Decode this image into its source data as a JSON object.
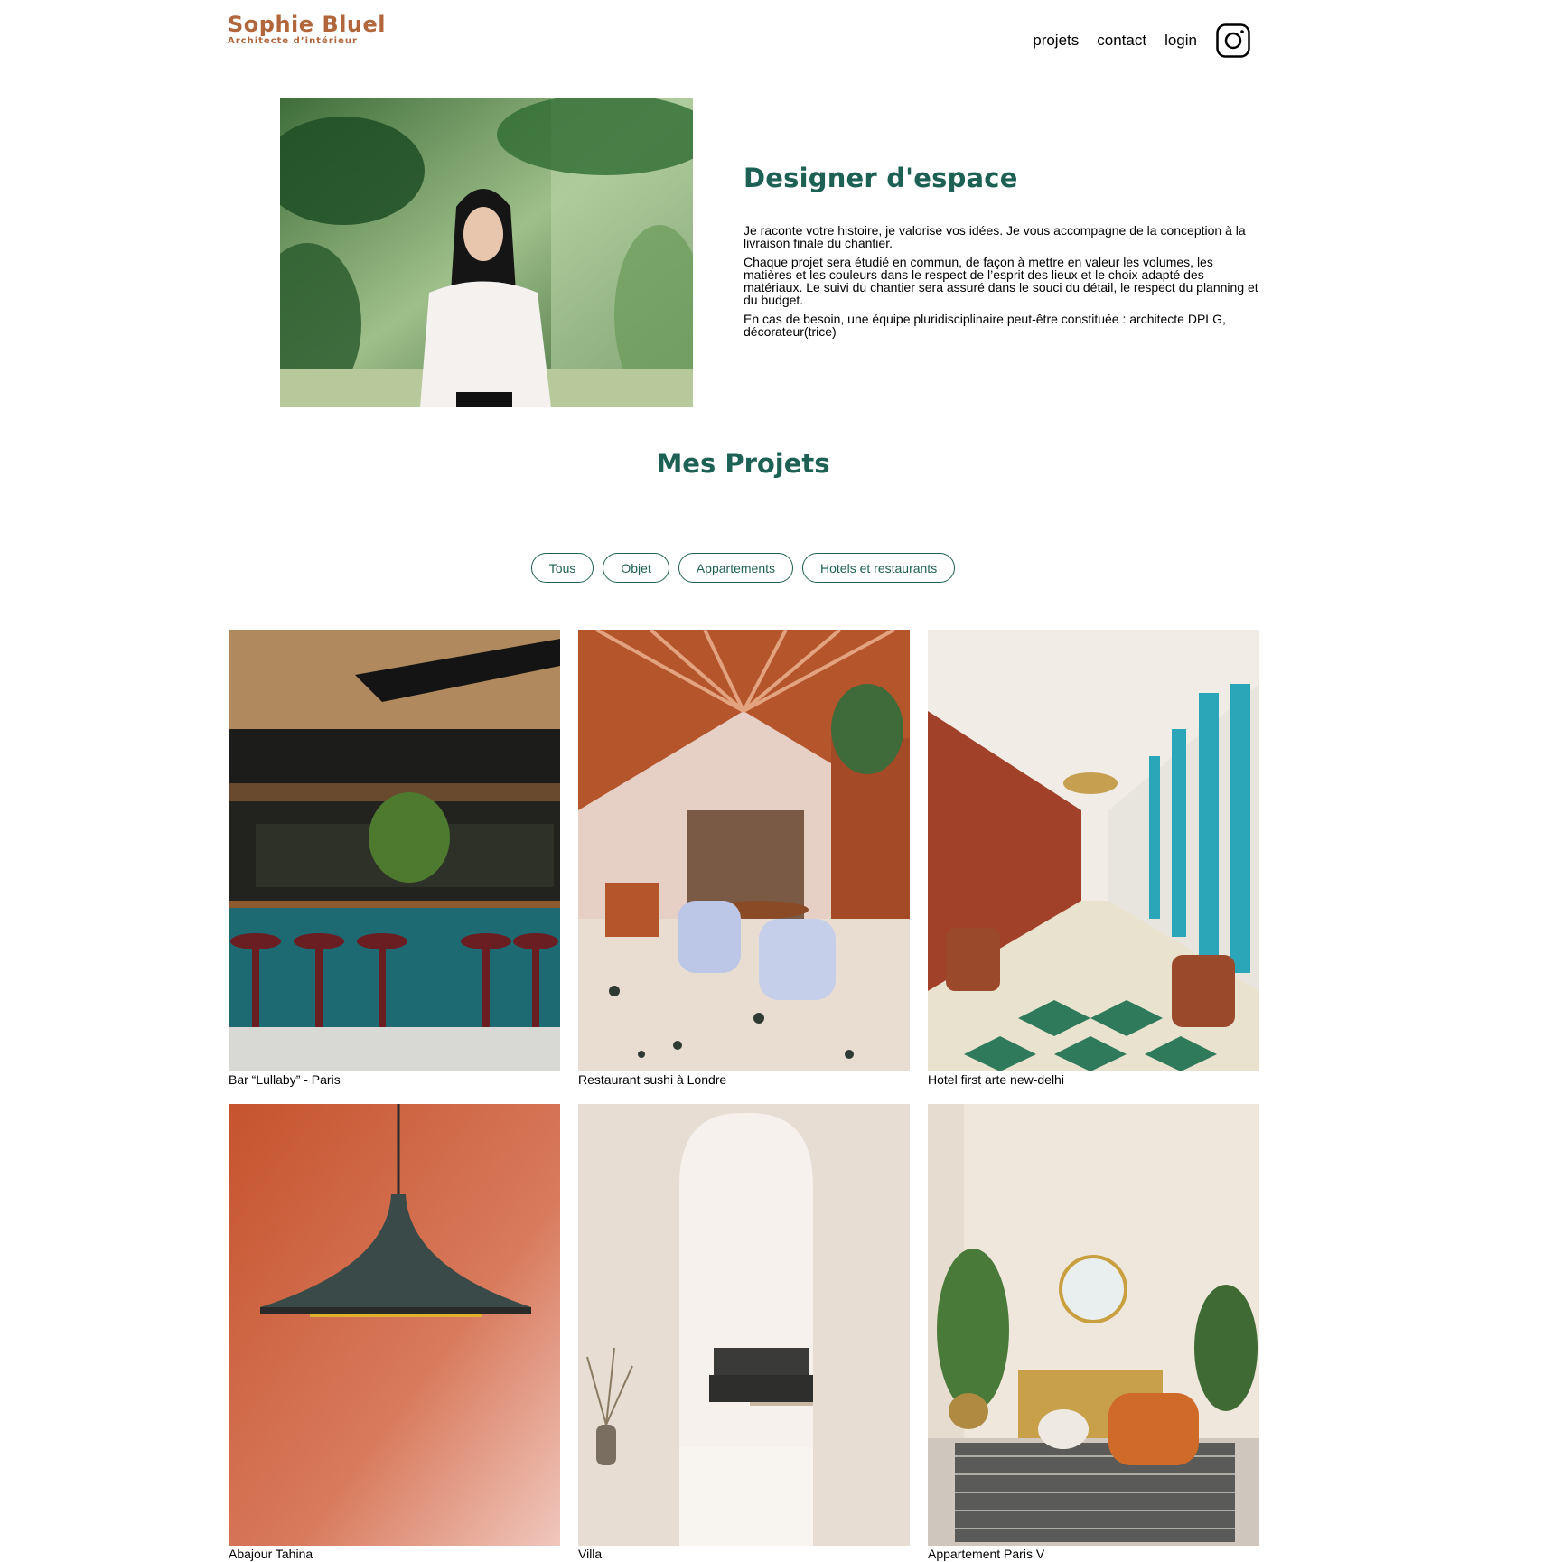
{
  "header": {
    "logo_name": "Sophie Bluel",
    "logo_subtitle": "Architecte d’intérieur",
    "nav": [
      "projets",
      "contact",
      "login"
    ],
    "social_icon": "instagram-icon"
  },
  "intro": {
    "title": "Designer d'espace",
    "paragraphs": [
      "Je raconte votre histoire, je valorise vos idées. Je vous accompagne de la conception à la livraison finale du chantier.",
      "Chaque projet sera étudié en commun, de façon à mettre en valeur les volumes, les matières et les couleurs dans le respect de l’esprit des lieux et le choix adapté des matériaux. Le suivi du chantier sera assuré dans le souci du détail, le respect du planning et du budget.",
      "En cas de besoin, une équipe pluridisciplinaire peut-être constituée : architecte DPLG, décorateur(trice)"
    ]
  },
  "projects": {
    "title": "Mes Projets",
    "filters": [
      "Tous",
      "Objet",
      "Appartements",
      "Hotels et restaurants"
    ],
    "items": [
      {
        "caption": "Bar “Lullaby” - Paris"
      },
      {
        "caption": "Restaurant sushi à Londre"
      },
      {
        "caption": "Hotel first arte new-delhi"
      },
      {
        "caption": "Abajour Tahina"
      },
      {
        "caption": "Villa"
      },
      {
        "caption": "Appartement Paris V"
      }
    ]
  },
  "colors": {
    "brand": "#B1663C",
    "accent": "#1D6154"
  }
}
